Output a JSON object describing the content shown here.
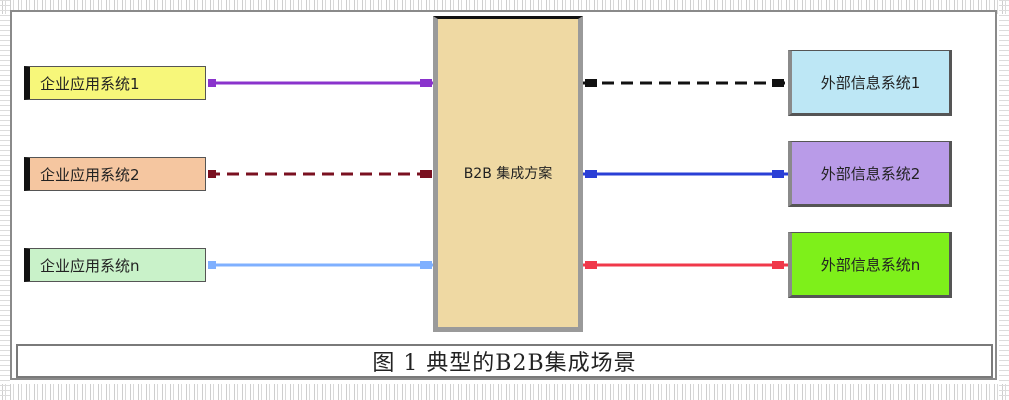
{
  "diagram": {
    "caption": "图 1 典型的B2B集成场景",
    "center": {
      "label": "B2B 集成方案",
      "fill": "#efd9a3"
    },
    "left_systems": [
      {
        "label": "企业应用系统1",
        "fill": "#f7f77a",
        "line_color": "#8a33cc",
        "line_style": "solid"
      },
      {
        "label": "企业应用系统2",
        "fill": "#f5c6a0",
        "line_color": "#7a1020",
        "line_style": "dashed"
      },
      {
        "label": "企业应用系统n",
        "fill": "#c9f2c9",
        "line_color": "#7fb0ff",
        "line_style": "solid"
      }
    ],
    "right_systems": [
      {
        "label": "外部信息系统1",
        "fill": "#bde7f5",
        "line_color": "#111111",
        "line_style": "dashed"
      },
      {
        "label": "外部信息系统2",
        "fill": "#b99be8",
        "line_color": "#2a3fd6",
        "line_style": "solid"
      },
      {
        "label": "外部信息系统n",
        "fill": "#7ef01a",
        "line_color": "#f0384a",
        "line_style": "solid"
      }
    ]
  }
}
